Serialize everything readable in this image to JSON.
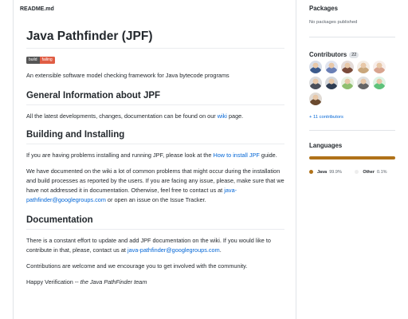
{
  "readme": {
    "filename": "README.md",
    "title": "Java Pathfinder (JPF)",
    "badge": {
      "left": "build",
      "right": "failing",
      "right_color": "#e05d44"
    },
    "intro": "An extensible software model checking framework for Java bytecode programs",
    "sections": {
      "general": {
        "heading": "General Information about JPF",
        "text_before": "All the latest developments, changes, documentation can be found on our ",
        "link": "wiki",
        "text_after": " page."
      },
      "building": {
        "heading": "Building and Installing",
        "p1_before": "If you are having problems installing and running JPF, please look at the ",
        "p1_link": "How to install JPF",
        "p1_after": " guide.",
        "p2_before": "We have documented on the wiki a lot of common problems that might occur during the installation and build processes as reported by the users. If you are facing any issue, please, make sure that we have not addressed it in documentation. Otherwise, feel free to contact us at ",
        "p2_link": "java-pathfinder@googlegroups.com",
        "p2_after": " or open an issue on the Issue Tracker."
      },
      "documentation": {
        "heading": "Documentation",
        "p1_before": "There is a constant effort to update and add JPF documentation on the wiki. If you would like to contribute in that, please, contact us at ",
        "p1_link": "java-pathfinder@googlegroups.com",
        "p1_after": ".",
        "p2": "Contributions are welcome and we encourage you to get involved with the community.",
        "p3_before": "Happy Verification -- ",
        "p3_em": "the Java PathFinder team"
      }
    }
  },
  "sidebar": {
    "packages": {
      "title": "Packages",
      "subtitle": "No packages published"
    },
    "contributors": {
      "title": "Contributors",
      "count": "22",
      "more_link": "+ 11 contributors",
      "avatar_colors": [
        "#3a5a8c",
        "#6a7fb5",
        "#7a4b3a",
        "#c9a77c",
        "#d8a48f",
        "#4a4f59",
        "#2f3d52",
        "#8fbf6f",
        "#666666",
        "#5ec27a",
        "#6b4a2f"
      ]
    },
    "languages": {
      "title": "Languages",
      "items": [
        {
          "name": "Java",
          "percent": "99.9%",
          "share": 0.999,
          "color": "#b07219"
        },
        {
          "name": "Other",
          "percent": "0.1%",
          "share": 0.001,
          "color": "#ededed"
        }
      ]
    }
  }
}
